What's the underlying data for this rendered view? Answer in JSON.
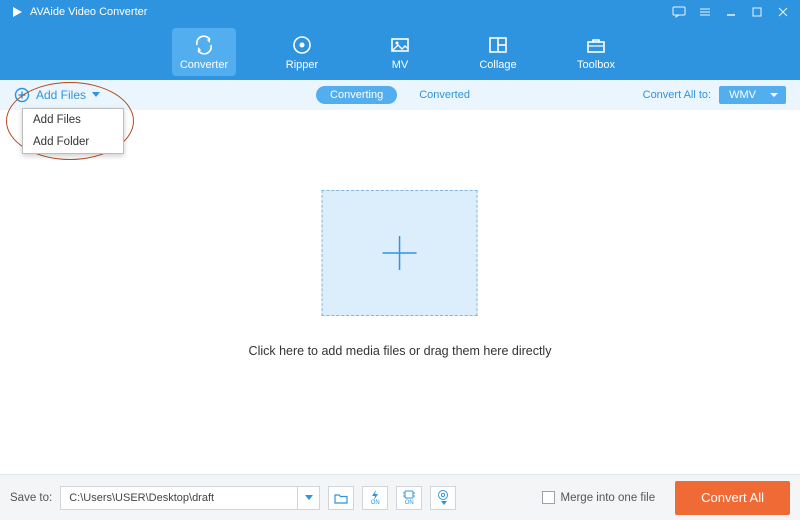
{
  "titlebar": {
    "app_name": "AVAide Video Converter"
  },
  "nav": {
    "converter": "Converter",
    "ripper": "Ripper",
    "mv": "MV",
    "collage": "Collage",
    "toolbox": "Toolbox"
  },
  "subbar": {
    "add_files": "Add Files",
    "tab_converting": "Converting",
    "tab_converted": "Converted",
    "convert_all_to_label": "Convert All to:",
    "selected_format": "WMV"
  },
  "dropdown": {
    "add_files": "Add Files",
    "add_folder": "Add Folder"
  },
  "dropzone": {
    "hint": "Click here to add media files or drag them here directly"
  },
  "bottom": {
    "save_to_label": "Save to:",
    "path": "C:\\Users\\USER\\Desktop\\draft",
    "merge_label": "Merge into one file",
    "convert_label": "Convert All",
    "on_badge": "ON"
  }
}
